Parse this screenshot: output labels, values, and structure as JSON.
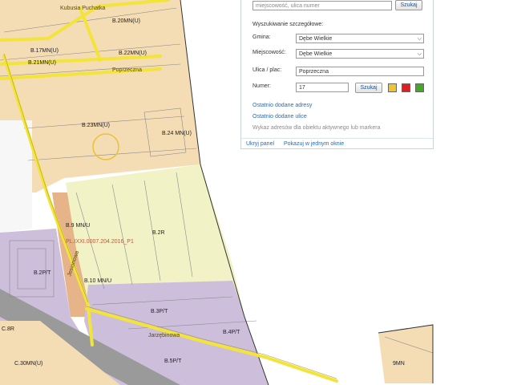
{
  "map": {
    "plan_label": "PL.IXXI.0007.204.2016_P1",
    "streets": {
      "kubusia": "Kubusia Puchatka",
      "poprzeczna": "Poprzeczna",
      "jarzebinowa": "Jarzębinowa",
      "jesionowa": "Jesionowa"
    },
    "zones": [
      "B.17MN(U)",
      "B.20MN(U)",
      "B.21MN(U)",
      "B.22MN(U)",
      "B.23MN(U)",
      "B.24 MN(U)",
      "B.9 MN/U",
      "B.2R",
      "B.2P/T",
      "B.10 MN/U",
      "B.3P/T",
      "B.4P/T",
      "B.5P/T",
      "C.8R",
      "C.30MN(U)",
      "9MN"
    ],
    "colors": {
      "residential": "#f4dcb5",
      "agricultural": "#f1f3c7",
      "industrial": "#cdbfdc",
      "service": "#e7b48a",
      "road": "#f2e43a",
      "rail": "#9a9a9a"
    }
  },
  "search": {
    "address_placeholder": "miejscowość, ulica numer",
    "address_button": "Szukaj",
    "detailed_title": "Wyszukiwanie szczegółowe:",
    "fields": {
      "gmina_label": "Gmina:",
      "gmina_value": "Dębe Wielkie",
      "miejscowosc_label": "Miejscowość:",
      "miejscowosc_value": "Dębe Wielkie",
      "ulica_label": "Ulica / plac:",
      "ulica_value": "Poprzeczna",
      "numer_label": "Numer:",
      "numer_value": "17"
    },
    "number_button": "Szukaj",
    "swatches": [
      "#f0c430",
      "#e02020",
      "#44aa22"
    ],
    "links": {
      "recent_addresses": "Ostatnio dodane adresy",
      "recent_streets": "Ostatnio dodane ulice",
      "note": "Wykaz adresów dla obiektu aktywnego lub markera"
    },
    "footer": {
      "hide_panel": "Ukryj panel",
      "open_window": "Pokazuj w jednym oknie"
    }
  }
}
